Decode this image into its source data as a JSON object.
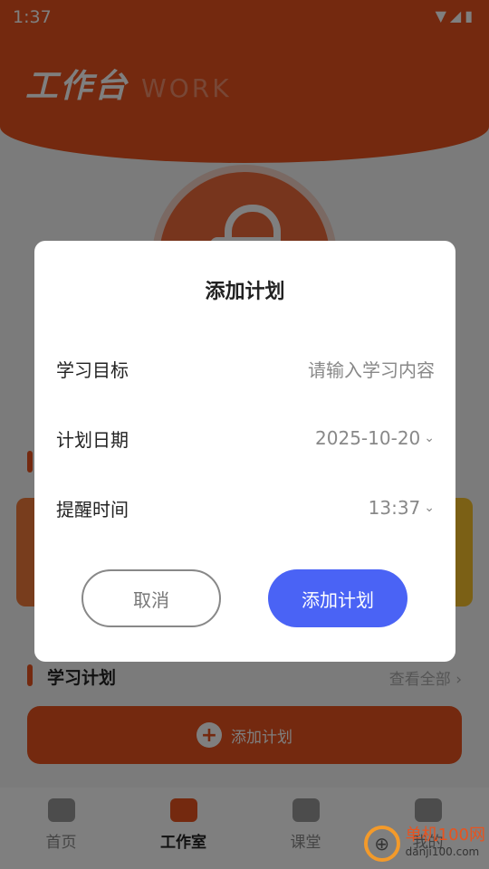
{
  "status_bar": {
    "time": "1:37",
    "icons": "▼◢▮"
  },
  "header": {
    "title": "工作台",
    "subtitle": "WORK"
  },
  "plan_section": {
    "title": "学习计划",
    "see_all": "查看全部 ›"
  },
  "add_bar": {
    "icon": "+",
    "label": "添加计划"
  },
  "tabs": [
    {
      "label": "首页",
      "icon": "home-icon"
    },
    {
      "label": "工作室",
      "icon": "book-icon",
      "active": true
    },
    {
      "label": "课堂",
      "icon": "tv-icon"
    },
    {
      "label": "我的",
      "icon": "user-icon"
    }
  ],
  "watermark": {
    "name": "单机100网",
    "url": "danji100.com"
  },
  "dialog": {
    "title": "添加计划",
    "goal_label": "学习目标",
    "goal_placeholder": "请输入学习内容",
    "date_label": "计划日期",
    "date_value": "2025-10-20",
    "reminder_label": "提醒时间",
    "reminder_value": "13:37",
    "cancel_label": "取消",
    "confirm_label": "添加计划"
  },
  "colors": {
    "brand": "#e8531e",
    "accent": "#4a63f5"
  }
}
